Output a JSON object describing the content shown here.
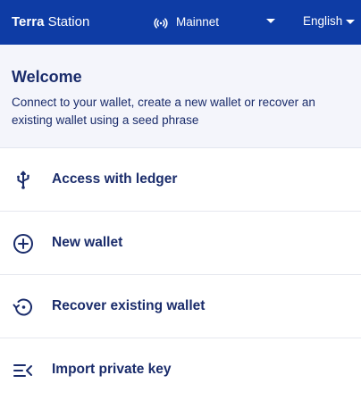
{
  "header": {
    "brand_bold": "Terra",
    "brand_light": "Station",
    "network_icon": "signal-icon",
    "network_label": "Mainnet",
    "language_label": "English"
  },
  "welcome": {
    "title": "Welcome",
    "description": "Connect to your wallet, create a new wallet or recover an existing wallet using a seed phrase"
  },
  "menu": {
    "items": [
      {
        "label": "Access with ledger",
        "icon": "usb-icon"
      },
      {
        "label": "New wallet",
        "icon": "add-circle-icon"
      },
      {
        "label": "Recover existing wallet",
        "icon": "restore-icon"
      },
      {
        "label": "Import private key",
        "icon": "import-list-icon"
      }
    ]
  },
  "colors": {
    "header_bg": "#0e3ca5",
    "text_primary": "#1a2c6b",
    "welcome_bg": "#f4f5fb"
  }
}
